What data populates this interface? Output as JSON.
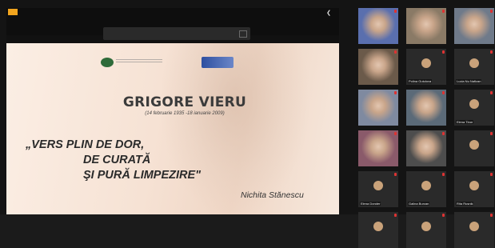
{
  "share": {
    "badge": "",
    "notice": "",
    "notice_button": "",
    "collapse_icon": "chevron-left-icon"
  },
  "slide": {
    "title": "GRIGORE VIERU",
    "dates": "(14 februarie 1935 -18 ianuarie 2009)",
    "quote_line1": "„VERS PLIN DE DOR,",
    "quote_line2": "DE CURATĂ",
    "quote_line3": "ŞI PURĂ LIMPEZIRE\"",
    "author": "Nichita Stănescu"
  },
  "participants": [
    {
      "name": "",
      "type": "video",
      "color": "#5a6fae"
    },
    {
      "name": "",
      "type": "video",
      "color": "#8a7a66"
    },
    {
      "name": "",
      "type": "video",
      "color": "#6f7a8a"
    },
    {
      "name": "",
      "type": "video",
      "color": "#6b5a4a"
    },
    {
      "name": "Polina Gutulova",
      "type": "avatar",
      "color": "#2a2a2a"
    },
    {
      "name": "Lucia Nu Nafizan",
      "type": "avatar",
      "color": "#2a2a2a"
    },
    {
      "name": "",
      "type": "video",
      "color": "#7f8aa0"
    },
    {
      "name": "",
      "type": "video",
      "color": "#5b6a78"
    },
    {
      "name": "Elena Tiron",
      "type": "avatar",
      "color": "#2a2a2a"
    },
    {
      "name": "",
      "type": "video",
      "color": "#8a5a6a"
    },
    {
      "name": "",
      "type": "video",
      "color": "#4d4d4d"
    },
    {
      "name": "",
      "type": "avatar",
      "color": "#2a2a2a"
    },
    {
      "name": "Elena Donder",
      "type": "avatar",
      "color": "#2a2a2a"
    },
    {
      "name": "Galina Burcan",
      "type": "avatar",
      "color": "#2a2a2a"
    },
    {
      "name": "Rita Rusnik",
      "type": "avatar",
      "color": "#2a2a2a"
    },
    {
      "name": "",
      "type": "avatar",
      "color": "#2a2a2a"
    },
    {
      "name": "",
      "type": "avatar",
      "color": "#2a2a2a"
    },
    {
      "name": "",
      "type": "avatar",
      "color": "#2a2a2a"
    }
  ]
}
